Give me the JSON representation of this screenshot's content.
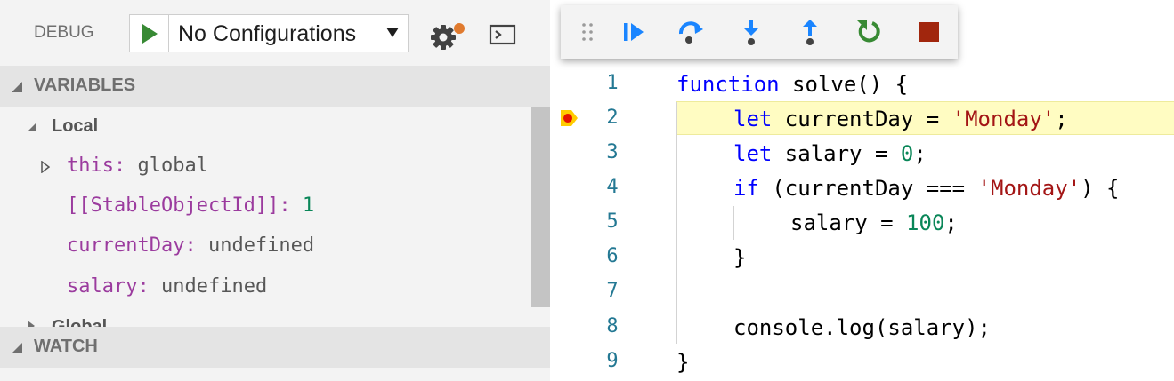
{
  "debug_header": {
    "title": "DEBUG",
    "configuration": "No Configurations"
  },
  "variables": {
    "section_title": "VARIABLES",
    "scopes": [
      {
        "label": "Local",
        "items": [
          {
            "name": "this",
            "value": "global",
            "expandable": true
          },
          {
            "name": "[[StableObjectId]]",
            "value": "1",
            "type": "number"
          },
          {
            "name": "currentDay",
            "value": "undefined"
          },
          {
            "name": "salary",
            "value": "undefined"
          }
        ]
      },
      {
        "label": "Global"
      }
    ]
  },
  "watch": {
    "section_title": "WATCH"
  },
  "toolbar": {
    "buttons": [
      {
        "icon": "continue-icon"
      },
      {
        "icon": "step-over-icon"
      },
      {
        "icon": "step-into-icon"
      },
      {
        "icon": "step-out-icon"
      },
      {
        "icon": "restart-icon"
      },
      {
        "icon": "stop-icon"
      }
    ]
  },
  "editor": {
    "current_line": 2,
    "breakpoint_line": 2,
    "lines": [
      {
        "number": "1",
        "text": "function solve() {"
      },
      {
        "number": "2",
        "text": "let currentDay = 'Monday';"
      },
      {
        "number": "3",
        "text": "let salary = 0;"
      },
      {
        "number": "4",
        "text": "if (currentDay === 'Monday') {"
      },
      {
        "number": "5",
        "text": "salary = 100;"
      },
      {
        "number": "6",
        "text": "}"
      },
      {
        "number": "7",
        "text": ""
      },
      {
        "number": "8",
        "text": "console.log(salary);"
      },
      {
        "number": "9",
        "text": "}"
      }
    ]
  },
  "colors": {
    "keyword": "#0000ff",
    "string": "#a31515",
    "number": "#098658",
    "variable_name": "#9b3b9e",
    "line_number": "#237893",
    "current_line_highlight": "#fffcc2",
    "start_green": "#388a34",
    "stop_red": "#a1260d",
    "step_blue": "#1a85ff"
  }
}
